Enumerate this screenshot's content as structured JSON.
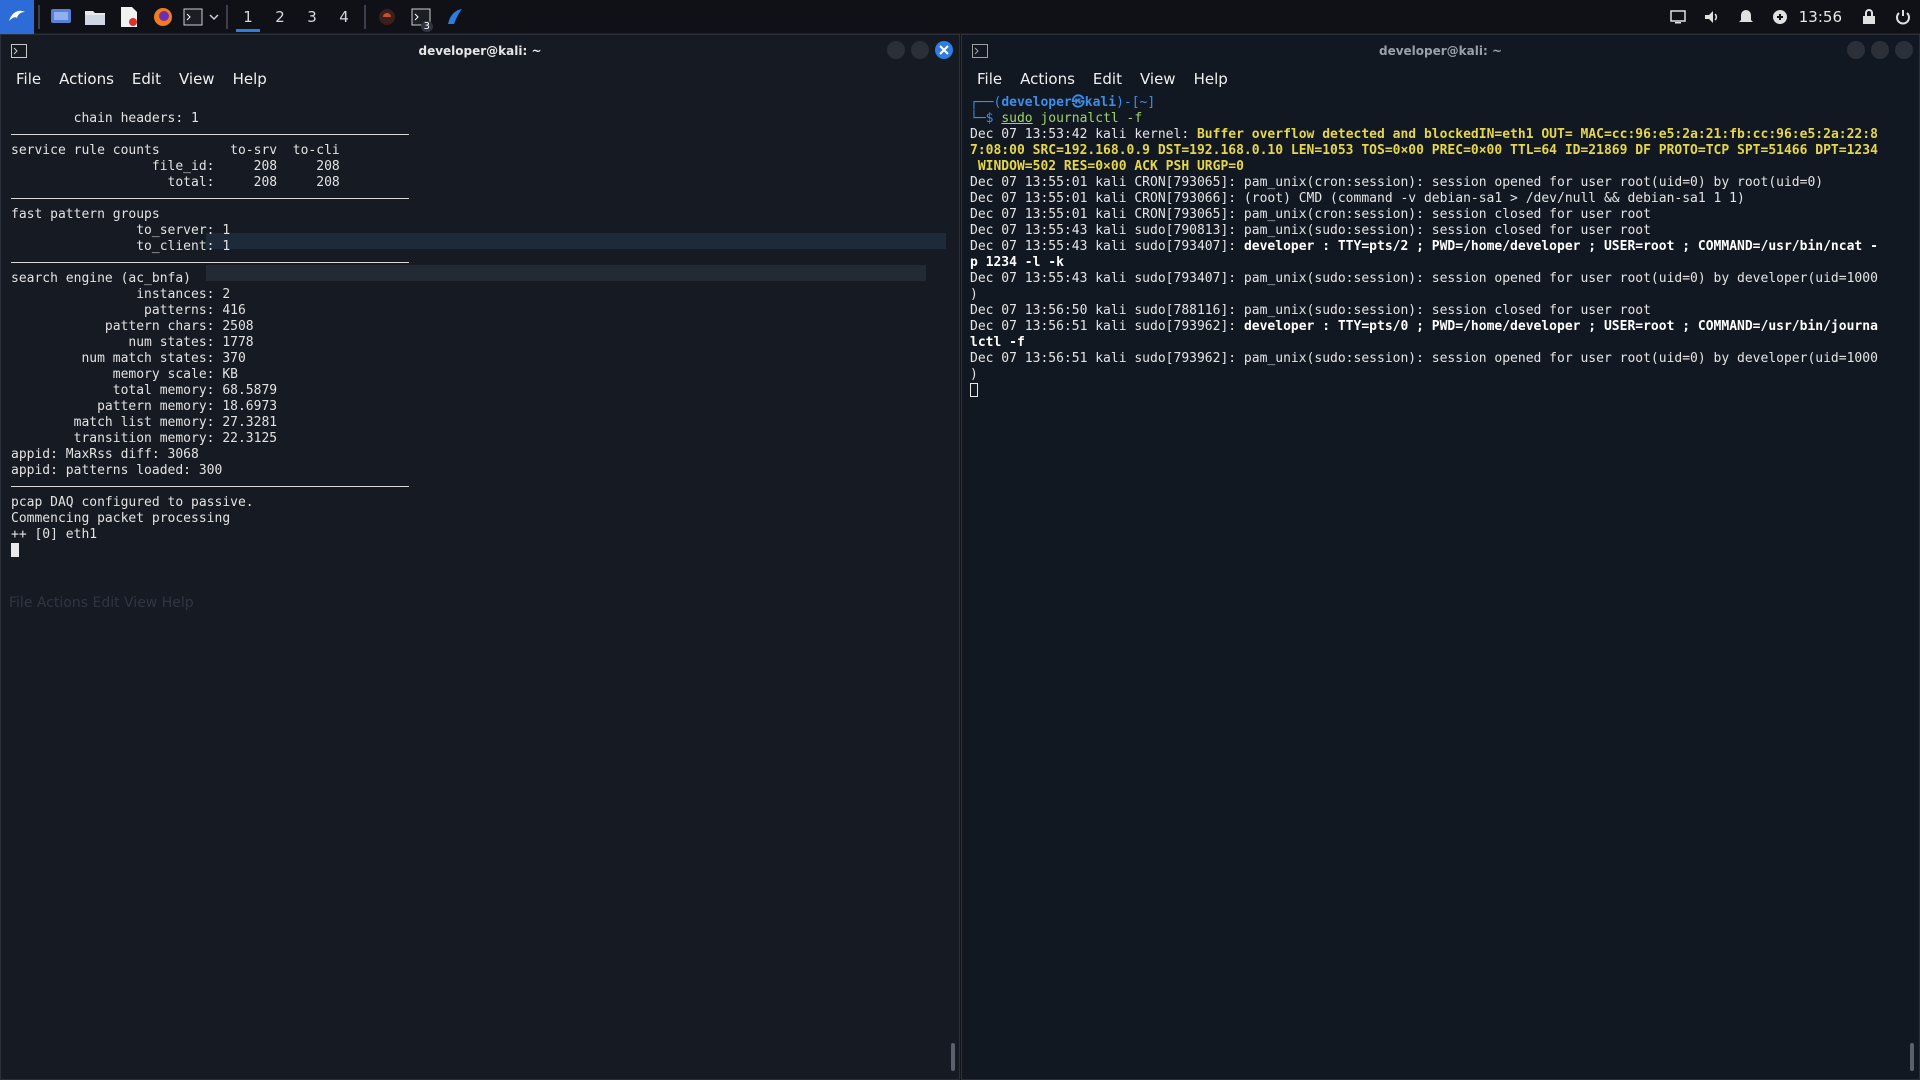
{
  "taskbar": {
    "workspaces": [
      "1",
      "2",
      "3",
      "4"
    ],
    "active_workspace": "1",
    "terminal_badge": "3",
    "clock": "13:56",
    "icons": [
      "kali-menu-icon",
      "desktop-icon",
      "file-manager-icon",
      "text-editor-icon",
      "firefox-icon",
      "terminal-icon",
      "dropdown-icon",
      "wireshark-icon",
      "terminal-group-icon",
      "app-icon"
    ],
    "tray_icons": [
      "display-icon",
      "volume-icon",
      "notification-icon",
      "network-icon",
      "lock-icon",
      "power-icon"
    ]
  },
  "left_window": {
    "title": "developer@kali: ~",
    "menu": [
      "File",
      "Actions",
      "Edit",
      "View",
      "Help"
    ],
    "terminal": {
      "block1": [
        "        chain headers: 1"
      ],
      "block2": [
        "service rule counts         to-srv  to-cli",
        "                  file_id:     208     208",
        "                    total:     208     208"
      ],
      "block3": [
        "fast pattern groups",
        "                to_server: 1",
        "                to_client: 1"
      ],
      "block4": [
        "search engine (ac_bnfa)",
        "                instances: 2",
        "                 patterns: 416",
        "            pattern chars: 2508",
        "               num states: 1778",
        "         num match states: 370",
        "             memory scale: KB",
        "             total memory: 68.5879",
        "           pattern memory: 18.6973",
        "        match list memory: 27.3281",
        "        transition memory: 22.3125",
        "appid: MaxRss diff: 3068",
        "appid: patterns loaded: 300"
      ],
      "block5": [
        "pcap DAQ configured to passive.",
        "Commencing packet processing",
        "++ [0] eth1"
      ]
    }
  },
  "right_window": {
    "title": "developer@kali: ~",
    "menu": [
      "File",
      "Actions",
      "Edit",
      "View",
      "Help"
    ],
    "prompt_top": "┌──(",
    "prompt_user": "developer㉿kali",
    "prompt_dir": ")-[~]",
    "prompt_bottom": "└─$ ",
    "command_sudo": "sudo",
    "command_rest": " journalctl -f",
    "log": {
      "l1_pre": "Dec 07 13:53:42 kali kernel: ",
      "l1_warn": "Buffer overflow detected and blockedIN=eth1 OUT= MAC=cc:96:e5:2a:21:fb:cc:96:e5:2a:22:8\n7:08:00 SRC=192.168.0.9 DST=192.168.0.10 LEN=1053 TOS=0×00 PREC=0×00 TTL=64 ID=21869 DF PROTO=TCP SPT=51466 DPT=1234\n WINDOW=502 RES=0×00 ACK PSH URGP=0",
      "l2": "Dec 07 13:55:01 kali CRON[793065]: pam_unix(cron:session): session opened for user root(uid=0) by root(uid=0)",
      "l3": "Dec 07 13:55:01 kali CRON[793066]: (root) CMD (command -v debian-sa1 > /dev/null && debian-sa1 1 1)",
      "l4": "Dec 07 13:55:01 kali CRON[793065]: pam_unix(cron:session): session closed for user root",
      "l5": "Dec 07 13:55:43 kali sudo[790813]: pam_unix(sudo:session): session closed for user root",
      "l6_pre": "Dec 07 13:55:43 kali sudo[793407]: ",
      "l6_bold": "developer : TTY=pts/2 ; PWD=/home/developer ; USER=root ; COMMAND=/usr/bin/ncat -\np 1234 -l -k",
      "l7": "Dec 07 13:55:43 kali sudo[793407]: pam_unix(sudo:session): session opened for user root(uid=0) by developer(uid=1000\n)",
      "l8": "Dec 07 13:56:50 kali sudo[788116]: pam_unix(sudo:session): session closed for user root",
      "l9_pre": "Dec 07 13:56:51 kali sudo[793962]: ",
      "l9_bold": "developer : TTY=pts/0 ; PWD=/home/developer ; USER=root ; COMMAND=/usr/bin/journa\nlctl -f",
      "l10": "Dec 07 13:56:51 kali sudo[793962]: pam_unix(sudo:session): session opened for user root(uid=0) by developer(uid=1000\n)"
    }
  },
  "colors": {
    "accent": "#2f7ddf",
    "prompt": "#3b8eea",
    "command": "#9fd36b",
    "warning": "#e6d74a"
  }
}
